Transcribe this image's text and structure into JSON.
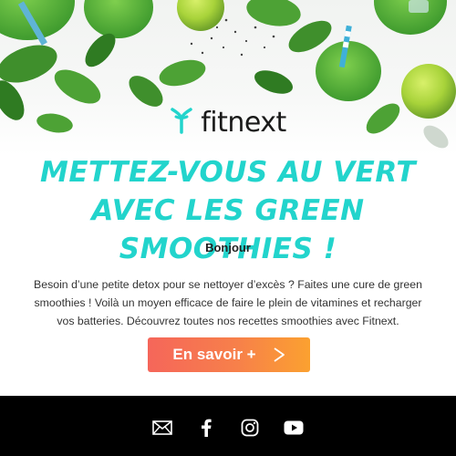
{
  "brand": {
    "name": "fitnext",
    "accent": "#22d4cc"
  },
  "headline": {
    "line1": "METTEZ-VOUS AU VERT",
    "line2": "AVEC LES GREEN SMOOTHIES !"
  },
  "greeting": "Bonjour",
  "body": "Besoin d’une petite detox pour se nettoyer d’excès ? Faites une cure de green smoothies ! Voilà un moyen efficace de faire le plein de vitamines et recharger vos batteries. Découvrez toutes nos recettes smoothies avec Fitnext.",
  "cta": {
    "label": "En savoir +",
    "icon": "chevron-right-icon"
  },
  "footer": {
    "background": "#000000",
    "social": [
      "mail-icon",
      "facebook-icon",
      "instagram-icon",
      "youtube-icon"
    ]
  }
}
